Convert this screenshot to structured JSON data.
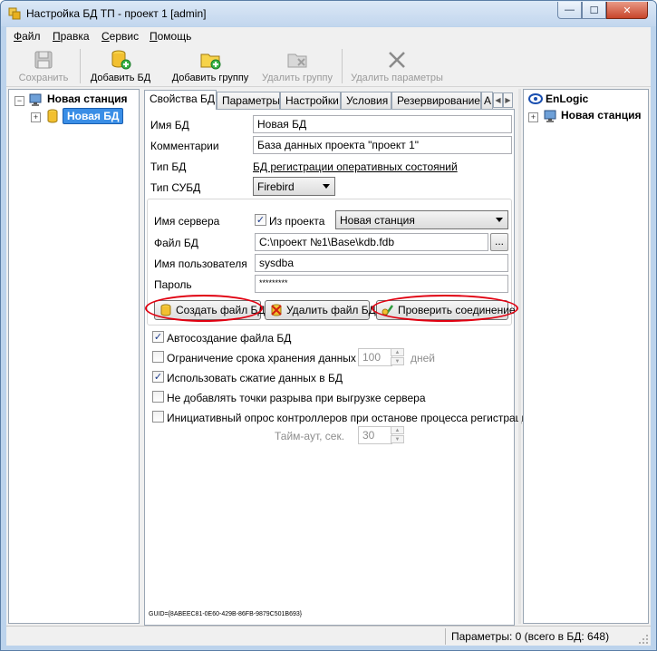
{
  "window": {
    "title": "Настройка БД ТП - проект 1 [admin]"
  },
  "menu": {
    "items": [
      {
        "accel": "Ф",
        "rest": "айл"
      },
      {
        "accel": "П",
        "rest": "равка"
      },
      {
        "accel": "С",
        "rest": "ервис"
      },
      {
        "accel": "П",
        "rest": "омощь"
      }
    ]
  },
  "toolbar": {
    "save": "Сохранить",
    "add_db": "Добавить БД",
    "add_group": "Добавить группу",
    "delete_group": "Удалить группу",
    "delete_params": "Удалить параметры"
  },
  "left_tree": {
    "station": "Новая станция",
    "db": "Новая БД"
  },
  "tabs": [
    "Свойства БД",
    "Параметры",
    "Настройки",
    "Условия",
    "Резервирование",
    "А"
  ],
  "props": {
    "name_label": "Имя БД",
    "name_value": "Новая БД",
    "comment_label": "Комментарии",
    "comment_value": "База данных проекта \"проект 1\"",
    "type_label": "Тип БД",
    "type_value": "БД регистрации оперативных состояний",
    "dbms_label": "Тип СУБД",
    "dbms_value": "Firebird"
  },
  "connection": {
    "server_label": "Имя сервера",
    "from_project_label": "Из проекта",
    "server_value": "Новая станция",
    "file_label": "Файл БД",
    "file_value": "C:\\проект №1\\Base\\kdb.fdb",
    "browse": "...",
    "user_label": "Имя пользователя",
    "user_value": "sysdba",
    "password_label": "Пароль",
    "password_value": "*********"
  },
  "buttons": {
    "create_file": "Создать файл БД",
    "delete_file": "Удалить файл БД",
    "check_connection": "Проверить соединение"
  },
  "options": {
    "autocreate": "Автосоздание файла БД",
    "limit_storage": "Ограничение срока хранения данных",
    "limit_value": "100",
    "limit_unit": "дней",
    "compression": "Использовать сжатие данных в БД",
    "no_breakpoints": "Не добавлять точки разрыва при выгрузке сервера",
    "initiative_poll": "Инициативный опрос контроллеров при останове процесса регистрации",
    "timeout_label": "Тайм-аут, сек.",
    "timeout_value": "30"
  },
  "guid": "GUID={8ABEEC81-0E60-429B-86FB-9879C501B693}",
  "right_tree": {
    "root": "EnLogic",
    "station": "Новая станция"
  },
  "status": {
    "text": "Параметры: 0 (всего в БД: 648)"
  }
}
